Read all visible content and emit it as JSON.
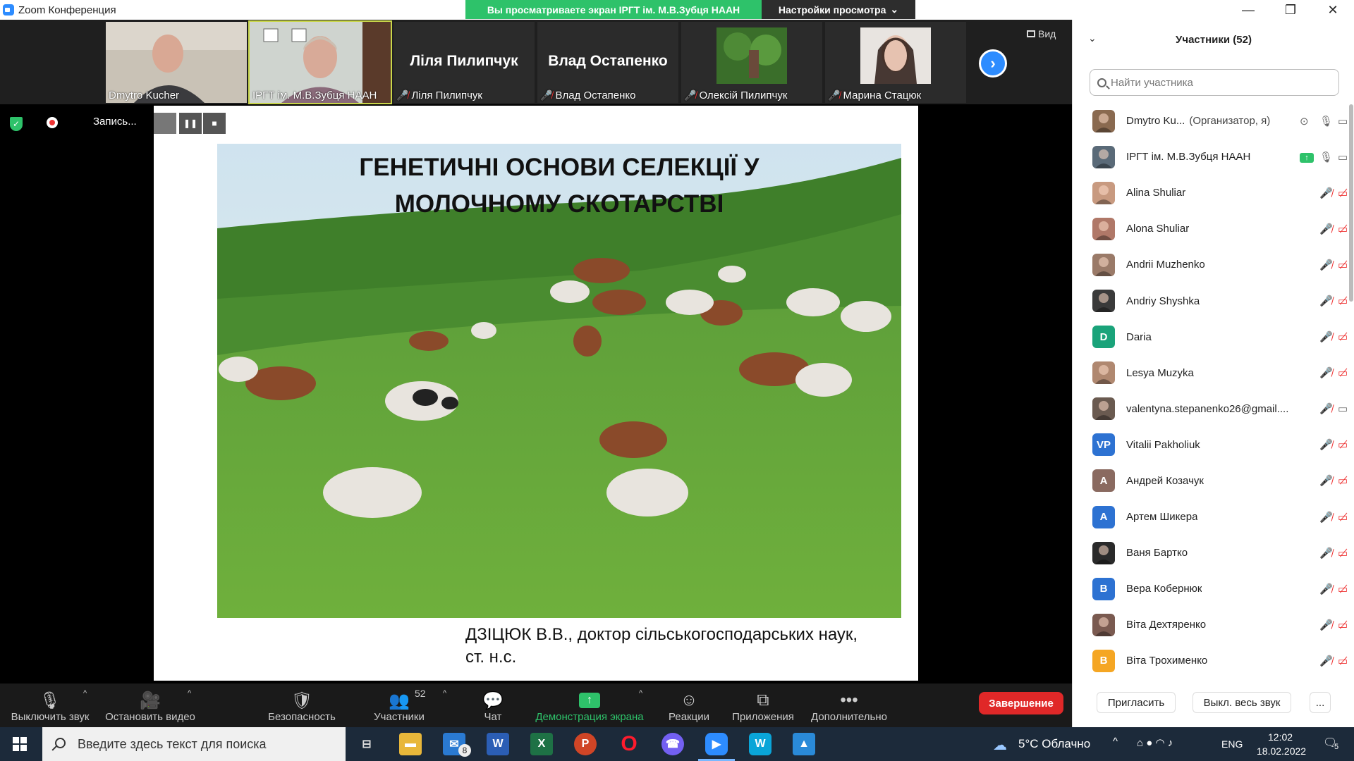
{
  "window": {
    "title": "Zoom Конференция",
    "share_banner": "Вы просматриваете экран ІРГТ ім. М.В.Зубця НААН",
    "view_settings": "Настройки просмотра"
  },
  "thumbs": [
    {
      "label": "Dmytro Kucher",
      "muted": false
    },
    {
      "label": "ІРГТ ім. М.В.Зубця НААН",
      "muted": false
    },
    {
      "label": "Ліля Пилипчук",
      "bigname": "Ліля Пилипчук",
      "muted": true
    },
    {
      "label": "Влад Остапенко",
      "bigname": "Влад Остапенко",
      "muted": true
    },
    {
      "label": "Олексій Пилипчук",
      "muted": true
    },
    {
      "label": "Марина Стацюк",
      "muted": true
    }
  ],
  "view_button": "Вид",
  "recording": {
    "label": "Запись..."
  },
  "slide": {
    "title_line1": "ГЕНЕТИЧНІ ОСНОВИ СЕЛЕКЦІЇ У",
    "title_line2": "МОЛОЧНОМУ СКОТАРСТВІ",
    "author_line1": "ДЗІЦЮК В.В., доктор сільськогосподарських наук,",
    "author_line2": "ст. н.с."
  },
  "toolbar": {
    "mute": "Выключить звук",
    "video": "Остановить видео",
    "security": "Безопасность",
    "participants": "Участники",
    "participants_count": "52",
    "chat": "Чат",
    "share": "Демонстрация экрана",
    "reactions": "Реакции",
    "apps": "Приложения",
    "more": "Дополнительно",
    "end": "Завершение"
  },
  "panel": {
    "title": "Участники (52)",
    "search_placeholder": "Найти участника",
    "invite": "Пригласить",
    "mute_all": "Выкл. весь звук",
    "more": "...",
    "participants": [
      {
        "name": "Dmytro Ku...",
        "role": "(Организатор, я)",
        "avatar": "photo",
        "color": "#8a6a50"
      },
      {
        "name": "ІРГТ ім. М.В.Зубця НААН",
        "role": "",
        "avatar": "photo",
        "color": "#5a6a78"
      },
      {
        "name": "Alina Shuliar",
        "role": "",
        "avatar": "photo",
        "color": "#c89a80"
      },
      {
        "name": "Alona Shuliar",
        "role": "",
        "avatar": "photo",
        "color": "#b07868"
      },
      {
        "name": "Andrii Muzhenko",
        "role": "",
        "avatar": "photo",
        "color": "#9a7a68"
      },
      {
        "name": "Andriy Shyshka",
        "role": "",
        "avatar": "photo",
        "color": "#3a3a3a"
      },
      {
        "name": "Daria",
        "role": "",
        "avatar": "D",
        "color": "#1aa37a"
      },
      {
        "name": "Lesya Muzyka",
        "role": "",
        "avatar": "photo",
        "color": "#b08870"
      },
      {
        "name": "valentyna.stepanenko26@gmail....",
        "role": "",
        "avatar": "photo",
        "color": "#6a5a50"
      },
      {
        "name": "Vitalii Pakholiuk",
        "role": "",
        "avatar": "VP",
        "color": "#2d72d2"
      },
      {
        "name": "Андрей Козачук",
        "role": "",
        "avatar": "А",
        "color": "#8a6a60"
      },
      {
        "name": "Артем Шикера",
        "role": "",
        "avatar": "A",
        "color": "#2d72d2"
      },
      {
        "name": "Ваня Бартко",
        "role": "",
        "avatar": "photo",
        "color": "#2a2a2a"
      },
      {
        "name": "Вера Кобернюк",
        "role": "",
        "avatar": "В",
        "color": "#2d72d2"
      },
      {
        "name": "Віта Дехтяренко",
        "role": "",
        "avatar": "photo",
        "color": "#7a5a50"
      },
      {
        "name": "Віта Трохименко",
        "role": "",
        "avatar": "В",
        "color": "#f5a623"
      }
    ]
  },
  "taskbar": {
    "search_placeholder": "Введите здесь текст для поиска",
    "mail_badge": "8",
    "weather": "5°C  Облачно",
    "lang": "ENG",
    "time": "12:02",
    "date": "18.02.2022",
    "notif_count": "5"
  }
}
